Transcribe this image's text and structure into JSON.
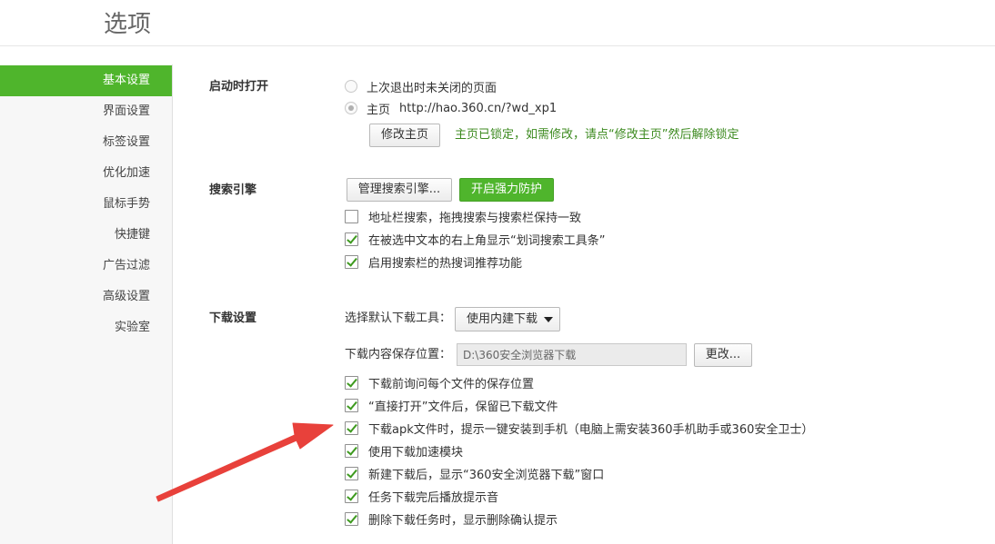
{
  "page_title": "选项",
  "sidebar": {
    "items": [
      {
        "label": "基本设置",
        "active": true
      },
      {
        "label": "界面设置"
      },
      {
        "label": "标签设置"
      },
      {
        "label": "优化加速"
      },
      {
        "label": "鼠标手势"
      },
      {
        "label": "快捷键"
      },
      {
        "label": "广告过滤"
      },
      {
        "label": "高级设置"
      },
      {
        "label": "实验室"
      }
    ]
  },
  "startup": {
    "label": "启动时打开",
    "option_last": "上次退出时未关闭的页面",
    "option_home": "主页",
    "home_url": "http://hao.360.cn/?wd_xp1",
    "modify_button": "修改主页",
    "lock_note": "主页已锁定，如需修改，请点“修改主页”然后解除锁定"
  },
  "search": {
    "label": "搜索引擎",
    "manage_button": "管理搜索引擎...",
    "protect_button": "开启强力防护",
    "options": [
      {
        "label": "地址栏搜索，拖拽搜索与搜索栏保持一致",
        "checked": false
      },
      {
        "label": "在被选中文本的右上角显示“划词搜索工具条”",
        "checked": true
      },
      {
        "label": "启用搜索栏的热搜词推荐功能",
        "checked": true
      }
    ]
  },
  "download": {
    "label": "下载设置",
    "tool_label": "选择默认下载工具：",
    "tool_value": "使用内建下载",
    "path_label": "下载内容保存位置：",
    "path_value": "D:\\360安全浏览器下载",
    "change_button": "更改...",
    "options": [
      {
        "label": "下载前询问每个文件的保存位置",
        "checked": true
      },
      {
        "label": "“直接打开”文件后，保留已下载文件",
        "checked": true
      },
      {
        "label": "下载apk文件时，提示一键安装到手机（电脑上需安装360手机助手或360安全卫士）",
        "checked": true
      },
      {
        "label": "使用下载加速模块",
        "checked": true
      },
      {
        "label": "新建下载后，显示“360安全浏览器下载”窗口",
        "checked": true
      },
      {
        "label": "任务下载完后播放提示音",
        "checked": true
      },
      {
        "label": "删除下载任务时，显示删除确认提示",
        "checked": true
      }
    ]
  },
  "colors": {
    "accent_green": "#4fb52c",
    "lock_note_green": "#3c8a1f",
    "annotation_arrow": "#e8413b"
  }
}
